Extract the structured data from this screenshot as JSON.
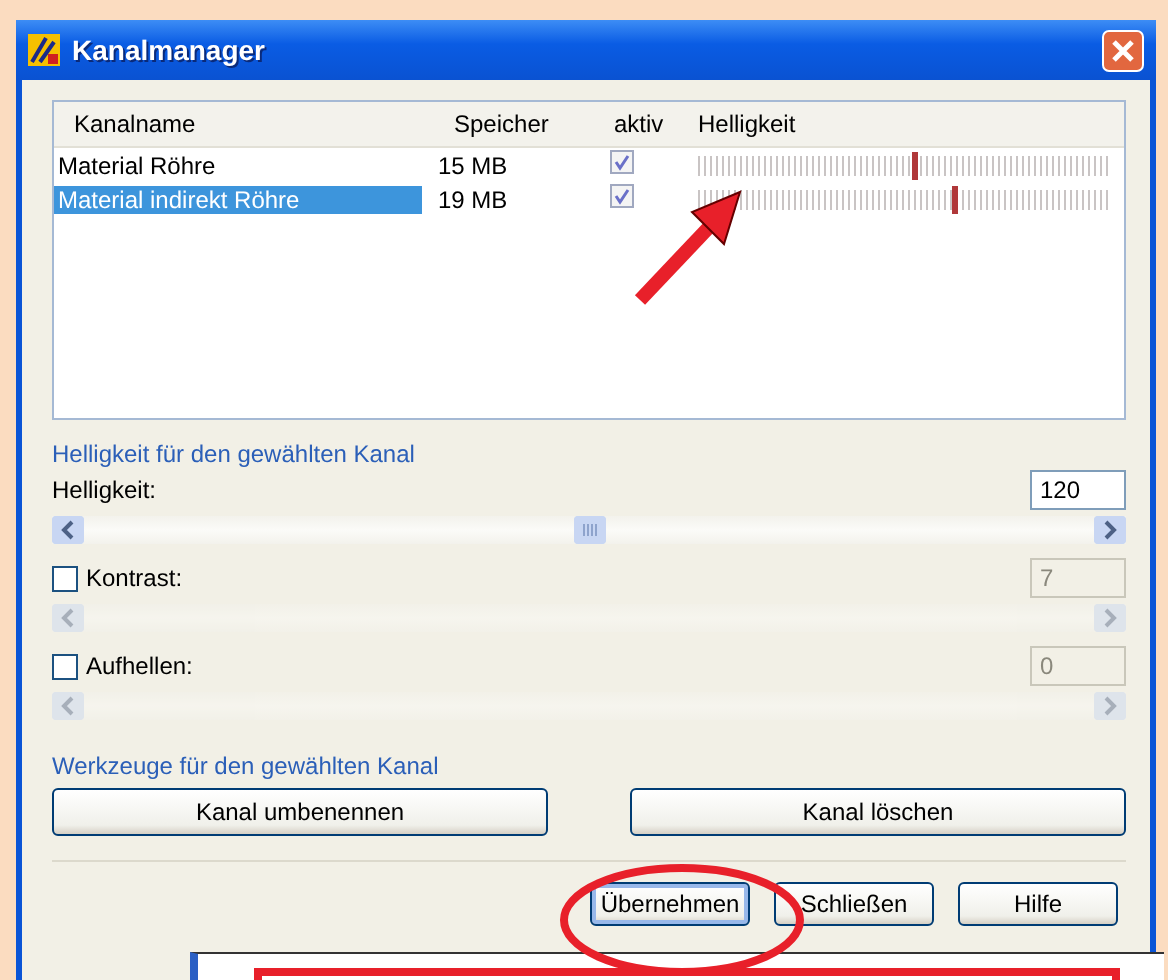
{
  "window": {
    "title": "Kanalmanager"
  },
  "channel_list": {
    "columns": [
      "Kanalname",
      "Speicher",
      "aktiv",
      "Helligkeit"
    ],
    "rows": [
      {
        "name": "Material Röhre",
        "memory": "15 MB",
        "active": true,
        "level": 0.52,
        "selected": false
      },
      {
        "name": "Material indirekt Röhre",
        "memory": "19 MB",
        "active": true,
        "level": 0.62,
        "selected": true
      }
    ]
  },
  "brightness_group": {
    "title": "Helligkeit für den gewählten Kanal",
    "settings": [
      {
        "kind": "plain",
        "label": "Helligkeit:",
        "value": "120",
        "disabled": false,
        "level": 0.5
      },
      {
        "kind": "checkbox",
        "label": "Kontrast:",
        "checked": false,
        "value": "7",
        "disabled": true
      },
      {
        "kind": "checkbox",
        "label": "Aufhellen:",
        "checked": false,
        "value": "0",
        "disabled": true
      }
    ]
  },
  "tools_group": {
    "title": "Werkzeuge für den gewählten Kanal",
    "buttons": [
      "Kanal umbenennen",
      "Kanal löschen"
    ]
  },
  "buttons": [
    {
      "label": "Übernehmen",
      "focused": true
    },
    {
      "label": "Schließen",
      "focused": false
    },
    {
      "label": "Hilfe",
      "focused": false
    }
  ]
}
